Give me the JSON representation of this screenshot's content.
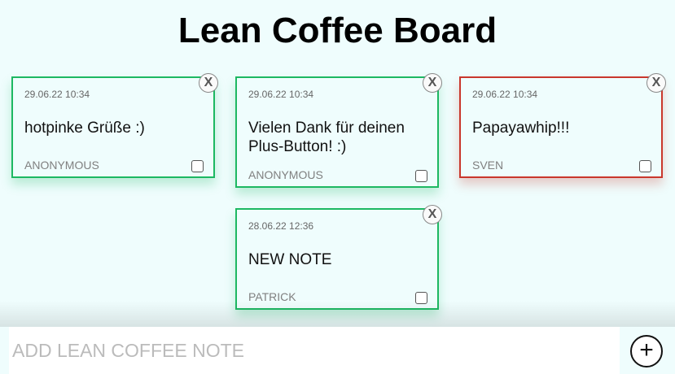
{
  "header": {
    "title": "Lean Coffee Board"
  },
  "notes": [
    {
      "date": "29.06.22 10:34",
      "text": "hotpinke Grüße :)",
      "author": "ANONYMOUS",
      "color": "#1db862",
      "close_label": "X",
      "checked": false
    },
    {
      "date": "29.06.22 10:34",
      "text": "Vielen Dank für deinen Plus-Button! :)",
      "author": "ANONYMOUS",
      "color": "#1db862",
      "close_label": "X",
      "checked": false
    },
    {
      "date": "29.06.22 10:34",
      "text": "Papayawhip!!!",
      "author": "SVEN",
      "color": "#c9372c",
      "close_label": "X",
      "checked": false
    },
    {
      "date": "28.06.22 12:36",
      "text": "NEW NOTE",
      "author": "PATRICK",
      "color": "#1db862",
      "close_label": "X",
      "checked": false
    }
  ],
  "add_note": {
    "placeholder": "ADD LEAN COFFEE NOTE",
    "value": "",
    "button_icon": "plus-icon",
    "button_label": "+"
  }
}
